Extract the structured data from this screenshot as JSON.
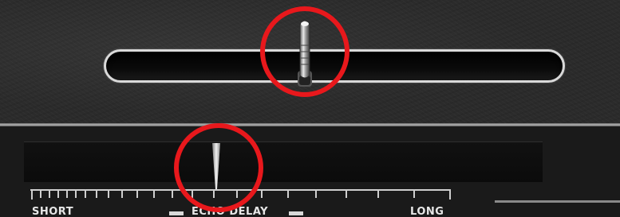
{
  "panel": {
    "upper_slider": {
      "name": "horizontal lever slider",
      "position_percent": 43
    },
    "echo_delay": {
      "title": "ECHO DELAY",
      "min_label": "SHORT",
      "max_label": "LONG",
      "pointer_percent": 44
    }
  },
  "highlights": [
    "upper-slider-thumb",
    "echo-delay-pointer"
  ],
  "colors": {
    "highlight": "#e8181c",
    "panel": "#2b2b2b",
    "scale_text": "#e6e6e6"
  }
}
